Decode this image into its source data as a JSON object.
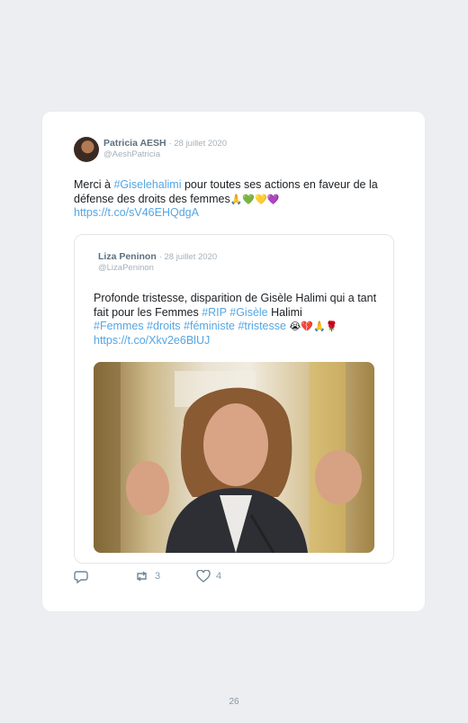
{
  "tweet": {
    "author_name": "Patricia AESH",
    "date": "· 28 juillet 2020",
    "handle": "@AeshPatricia",
    "text_part1": "Merci à ",
    "hashtag": "#Giselehalimi",
    "text_part2": " pour toutes ses actions en faveur de la défense des droits des femmes",
    "emojis": "🙏💚💛💜",
    "link": "https://t.co/sV46EHQdgA"
  },
  "quoted": {
    "author_name": "Liza Peninon",
    "date": "· 28 juillet 2020",
    "handle": "@LizaPeninon",
    "text_part1": "Profonde tristesse, disparition de Gisèle Halimi qui a tant fait pour les Femmes ",
    "tag_rip": "#RIP",
    "tag_gisele": "#Gisèle",
    "text_part2": " Halimi ",
    "tags_line": "#Femmes #droits #féministe #tristesse",
    "emojis": "😭💔🙏🌹",
    "link": "https://t.co/Xkv2e6BlUJ"
  },
  "actions": {
    "reply_icon": "reply-icon",
    "retweet_icon": "retweet-icon",
    "retweet_count": "3",
    "like_icon": "heart-icon",
    "like_count": "4"
  },
  "page_number": "26",
  "colors": {
    "background": "#eceef1",
    "card": "#ffffff",
    "link": "#55a6e4",
    "name": "#5b6f80",
    "muted": "#a6b0b9"
  }
}
